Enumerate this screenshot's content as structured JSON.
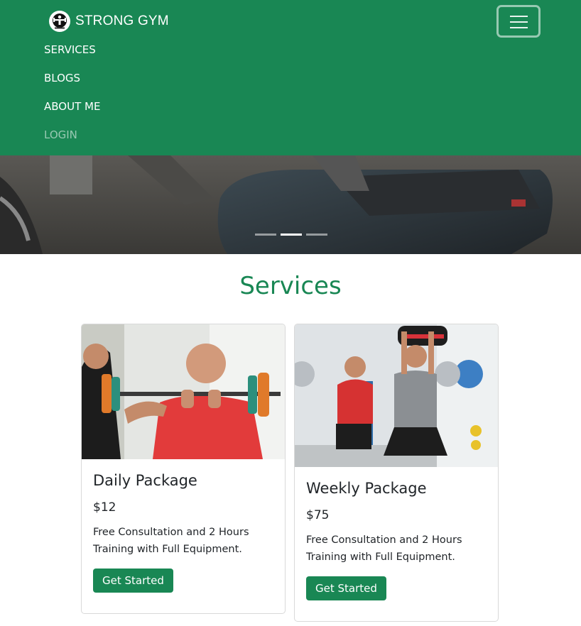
{
  "navbar": {
    "brand_name": "STRONG GYM",
    "brand_icon": "gym-logo-icon",
    "toggler_icon": "hamburger-menu-icon",
    "links": [
      {
        "label": "SERVICES"
      },
      {
        "label": "BLOGS"
      },
      {
        "label": "ABOUT ME"
      },
      {
        "label": "LOGIN"
      }
    ]
  },
  "carousel": {
    "slide_count": 3,
    "active_index": 1
  },
  "services": {
    "title": "Services",
    "cards": [
      {
        "title": "Daily Package",
        "price": "$12",
        "description": "Free Consultation and 2 Hours Training with Full Equipment.",
        "button": "Get Started"
      },
      {
        "title": "Weekly Package",
        "price": "$75",
        "description": "Free Consultation and 2 Hours Training with Full Equipment.",
        "button": "Get Started"
      }
    ]
  },
  "colors": {
    "brand_green": "#198754",
    "text_dark": "#212529"
  }
}
